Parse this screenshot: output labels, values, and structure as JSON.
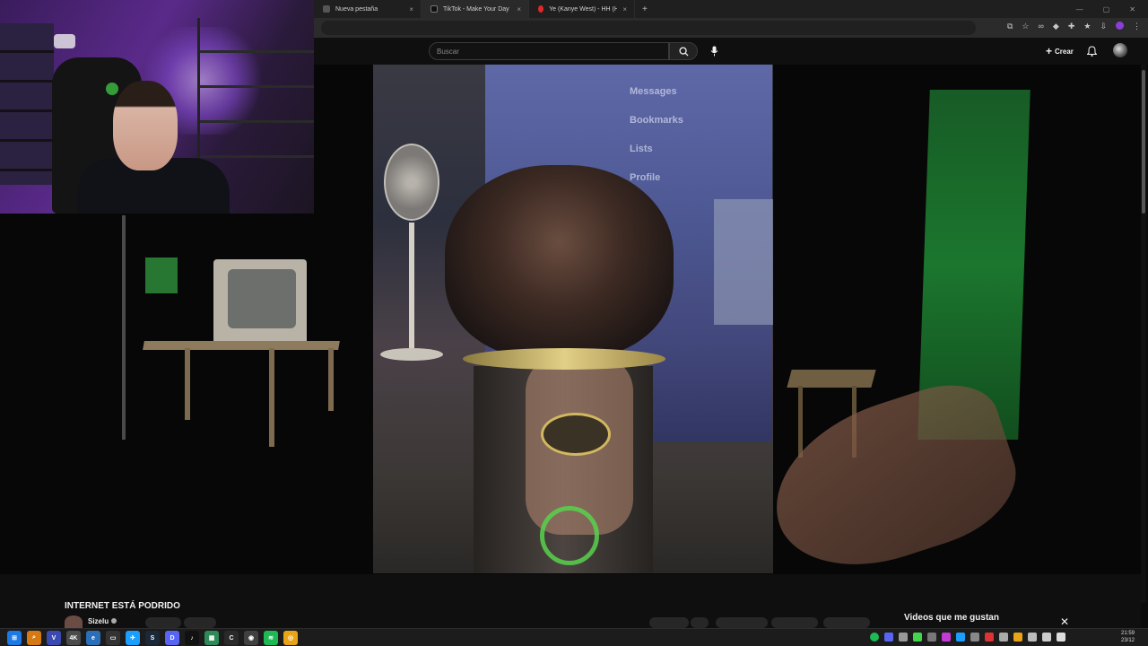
{
  "browser": {
    "tabs": [
      {
        "title": "Nueva pestaña",
        "close": "×"
      },
      {
        "title": "TikTok - Make Your Day",
        "close": "×"
      },
      {
        "title": "Ye (Kanye West) - HH (Happy H",
        "close": "×"
      }
    ],
    "new_tab": "+",
    "window_controls": [
      "—",
      "▢",
      "✕"
    ]
  },
  "youtube": {
    "search_placeholder": "Buscar",
    "create_label": "Crear",
    "video": {
      "title": "INTERNET ESTÁ PODRIDO",
      "channel": "Sizelu"
    },
    "liked_panel": {
      "title": "Videos que me gustan",
      "close": "✕"
    },
    "video_overlay_text": [
      "Messages",
      "Bookmarks",
      "Lists",
      "Profile"
    ]
  },
  "taskbar": {
    "time": "21:59",
    "date": "23/12",
    "app_icons": [
      "windows-start",
      "search",
      "vivaldi",
      "app-4k",
      "edge",
      "steam",
      "discord",
      "tiktok",
      "capcut",
      "obs",
      "spotify",
      "chrome"
    ]
  },
  "colors": {
    "accent": "#8b3fd9",
    "youtube_red": "#e02828",
    "tray_green": "#1db954"
  }
}
